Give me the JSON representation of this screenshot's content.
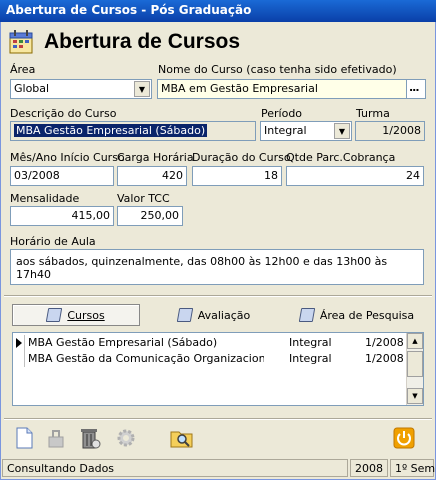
{
  "window": {
    "title": "Abertura de Cursos - Pós Graduação"
  },
  "header": {
    "title": "Abertura de Cursos",
    "icon": "calendar-icon"
  },
  "form": {
    "area": {
      "label": "Área",
      "value": "Global"
    },
    "nome_curso": {
      "label": "Nome do Curso (caso tenha sido efetivado)",
      "value": "MBA em Gestão Empresarial",
      "button": "..."
    },
    "descricao": {
      "label": "Descrição do Curso",
      "value": "MBA Gestão Empresarial (Sábado)"
    },
    "periodo": {
      "label": "Período",
      "value": "Integral"
    },
    "turma": {
      "label": "Turma",
      "value": "1/2008"
    },
    "mes_ano": {
      "label": "Mês/Ano Início Curso",
      "value": "03/2008"
    },
    "carga": {
      "label": "Carga Horária",
      "value": "420"
    },
    "duracao": {
      "label": "Duração do Curso",
      "value": "18"
    },
    "parcelas": {
      "label": "Qtde Parc.Cobrança",
      "value": "24"
    },
    "mensalidade": {
      "label": "Mensalidade",
      "value": "415,00"
    },
    "valor_tcc": {
      "label": "Valor TCC",
      "value": "250,00"
    },
    "horario": {
      "label": "Horário de Aula",
      "value": "aos sábados, quinzenalmente, das 08h00 às 12h00 e das 13h00 às 17h40"
    }
  },
  "tabs": [
    {
      "label": "Cursos",
      "active": true
    },
    {
      "label": "Avaliação",
      "active": false
    },
    {
      "label": "Área de Pesquisa",
      "active": false
    }
  ],
  "grid": {
    "rows": [
      {
        "nome": "MBA Gestão Empresarial (Sábado)",
        "periodo": "Integral",
        "turma": "1/2008",
        "selected": true
      },
      {
        "nome": "MBA Gestão da Comunicação Organizacional (Sáb",
        "periodo": "Integral",
        "turma": "1/2008",
        "selected": false
      }
    ]
  },
  "toolbar": [
    "new-document-icon",
    "disabled-tool-icon",
    "trash-icon",
    "disabled-gear-icon",
    "search-folder-icon",
    "power-icon"
  ],
  "status": {
    "message": "Consultando Dados",
    "year": "2008",
    "semester": "1º Sem"
  },
  "colors": {
    "title_bar": "#0a3fa8",
    "selection": "#0a246a",
    "input_border": "#7f9db9",
    "power": "#f0a000"
  }
}
